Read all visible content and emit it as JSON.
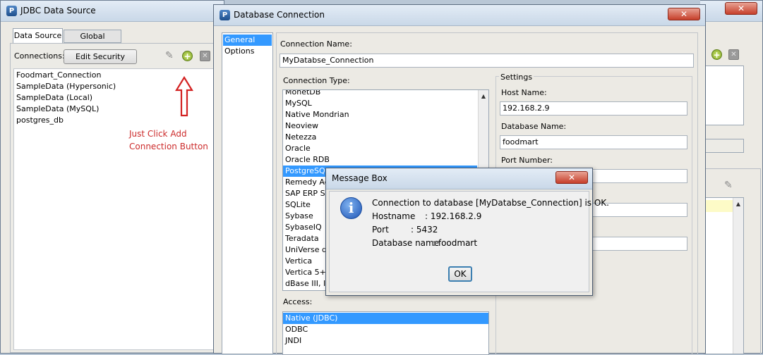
{
  "jdbc_window": {
    "title": "JDBC Data Source",
    "tabs": [
      "Data Source",
      "Global Scripting"
    ],
    "connections_label": "Connections:",
    "edit_security_label": "Edit Security",
    "connections": [
      "Foodmart_Connection",
      "SampleData (Hypersonic)",
      "SampleData (Local)",
      "SampleData (MySQL)",
      "postgres_db"
    ],
    "annotation_line1": "Just Click Add",
    "annotation_line2": "Connection Button",
    "annotation_color": "#cc2b2b"
  },
  "db_dialog": {
    "title": "Database Connection",
    "close_label": "✕",
    "nav": [
      "General",
      "Options"
    ],
    "connection_name_label": "Connection Name:",
    "connection_name_value": "MyDatabse_Connection",
    "connection_type_label": "Connection Type:",
    "connection_types": [
      "MonetDB",
      "MySQL",
      "Native Mondrian",
      "Neoview",
      "Netezza",
      "Oracle",
      "Oracle RDB",
      "PostgreSQL",
      "Remedy Acti",
      "SAP ERP Sys",
      "SQLite",
      "Sybase",
      "SybaseIQ",
      "Teradata",
      "UniVerse dat",
      "Vertica",
      "Vertica 5+",
      "dBase III, IV"
    ],
    "selected_type": "PostgreSQL",
    "access_label": "Access:",
    "access_options": [
      "Native (JDBC)",
      "ODBC",
      "JNDI"
    ],
    "settings_label": "Settings",
    "host_name_label": "Host Name:",
    "host_name_value": "192.168.2.9",
    "database_name_label": "Database Name:",
    "database_name_value": "foodmart",
    "port_number_label": "Port Number:"
  },
  "message_box": {
    "title": "Message Box",
    "close_label": "✕",
    "line1": "Connection to database [MyDatabse_Connection] is OK.",
    "hostname_label": "Hostname",
    "hostname_value": ": 192.168.2.9",
    "port_label": "Port",
    "port_value": ": 5432",
    "dbname_label": "Database name",
    "dbname_value": ": foodmart",
    "ok_label": "OK",
    "info_icon": "i"
  },
  "bg_window": {
    "close_label": "✕"
  },
  "icons": {
    "edit": "✎",
    "add": "+",
    "delete": "✕",
    "up": "▲",
    "down": "▼"
  }
}
